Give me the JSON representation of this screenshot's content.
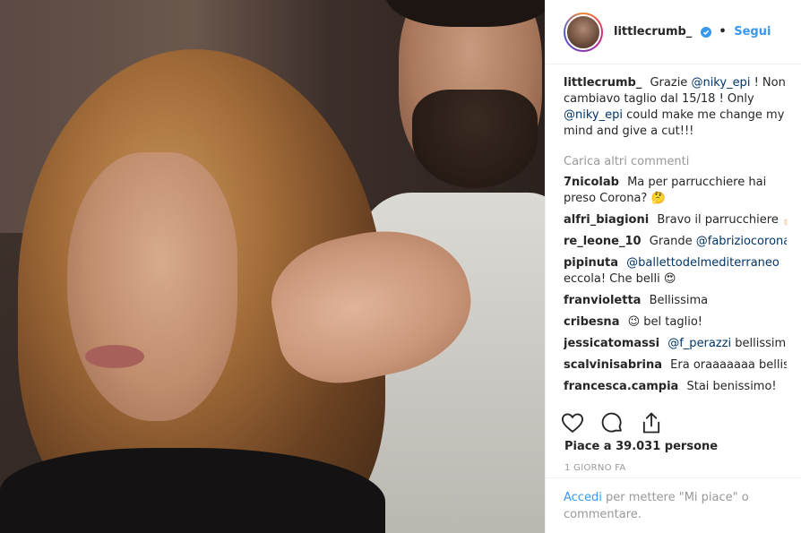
{
  "header": {
    "username": "littlecrumb_",
    "dot": "•",
    "follow_label": "Segui"
  },
  "caption": {
    "username": "littlecrumb_",
    "text_1": "Grazie",
    "mention_1": "@niky_epi",
    "text_2": "! Non cambiavo taglio dal 15/18 ! Only",
    "mention_2": "@niky_epi",
    "text_3": "could make me change my mind and give a cut!!!"
  },
  "load_more": "Carica altri commenti",
  "comments": [
    {
      "user": "7nicolab",
      "text": "Ma per parrucchiere hai preso Corona? 🤔"
    },
    {
      "user": "alfri_biagioni",
      "text": "Bravo il parrucchiere 👍🏻"
    },
    {
      "user": "re_leone_10",
      "pre": "Grande",
      "mention": "@fabriziocoronareal",
      "post": ""
    },
    {
      "user": "pipinuta",
      "pre": "",
      "mention": "@ballettodelmediterraneo",
      "post": "eccola! Che belli 😍"
    },
    {
      "user": "franvioletta",
      "text": "Bellissima"
    },
    {
      "user": "cribesna",
      "text": "😉 bel taglio!"
    },
    {
      "user": "jessicatomassi",
      "pre": "",
      "mention": "@f_perazzi",
      "post": "bellissimi!!!!"
    },
    {
      "user": "scalvinisabrina",
      "text": "Era oraaaaaaa bellissima"
    },
    {
      "user": "francesca.campia",
      "text": "Stai benissimo!"
    }
  ],
  "likes": "Piace a 39.031 persone",
  "time": "1 GIORNO FA",
  "login": {
    "link": "Accedi",
    "text": "per mettere \"Mi piace\" o commentare."
  },
  "icons": [
    "verified-badge-icon",
    "heart-icon",
    "comment-icon",
    "share-icon"
  ],
  "colors": {
    "link": "#3897f0",
    "mention": "#003569",
    "muted": "#999999"
  }
}
